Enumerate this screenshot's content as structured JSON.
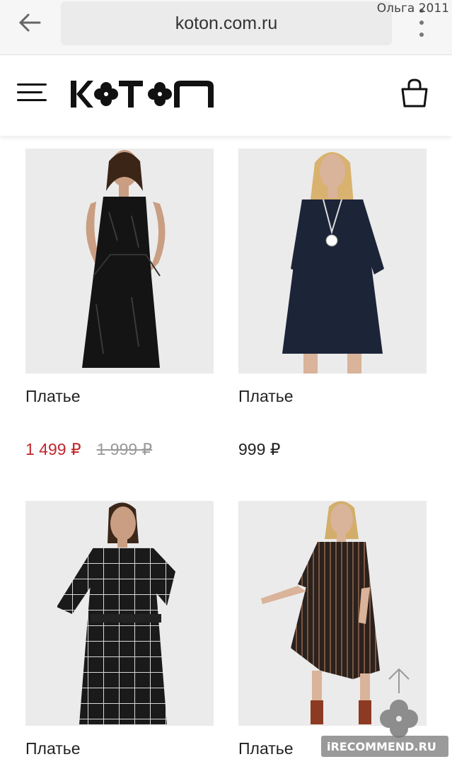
{
  "browser": {
    "url": "koton.com.ru",
    "user": "Ольга 2011"
  },
  "header": {
    "logo_text": "KOTON"
  },
  "products": [
    {
      "name": "Платье",
      "sale_price": "1 499 ₽",
      "old_price": "1 999 ₽",
      "dress_color": "#141414"
    },
    {
      "name": "Платье",
      "price": "999 ₽",
      "dress_color": "#1c2438"
    },
    {
      "name": "Платье",
      "dress_color": "#1a1a1a"
    },
    {
      "name": "Платье",
      "dress_color": "#2b211d"
    }
  ],
  "watermark": "iRECOMMEND.RU",
  "colors": {
    "sale": "#c1272d",
    "text": "#222222",
    "image_bg": "#ebebeb"
  }
}
